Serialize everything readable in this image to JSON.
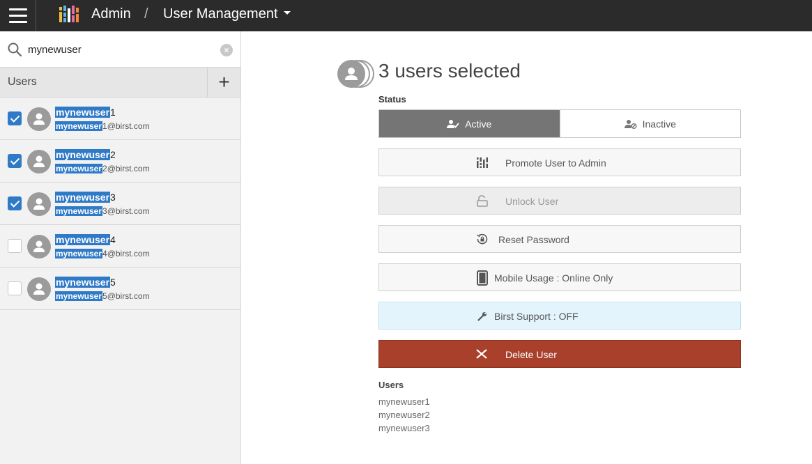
{
  "header": {
    "app": "Admin",
    "separator": "/",
    "section": "User Management"
  },
  "search": {
    "value": "mynewuser",
    "placeholder": ""
  },
  "users_panel": {
    "title": "Users",
    "add_label": "+"
  },
  "users": [
    {
      "match": "mynewuser",
      "suffix": "1",
      "email_suffix": "1@birst.com",
      "checked": true
    },
    {
      "match": "mynewuser",
      "suffix": "2",
      "email_suffix": "2@birst.com",
      "checked": true
    },
    {
      "match": "mynewuser",
      "suffix": "3",
      "email_suffix": "3@birst.com",
      "checked": true
    },
    {
      "match": "mynewuser",
      "suffix": "4",
      "email_suffix": "4@birst.com",
      "checked": false
    },
    {
      "match": "mynewuser",
      "suffix": "5",
      "email_suffix": "5@birst.com",
      "checked": false
    }
  ],
  "detail": {
    "headline": "3 users selected",
    "status_label": "Status",
    "status_active": "Active",
    "status_inactive": "Inactive",
    "promote": "Promote User to Admin",
    "unlock": "Unlock User",
    "reset": "Reset Password",
    "mobile": "Mobile Usage : Online Only",
    "support": "Birst Support : OFF",
    "delete": "Delete User",
    "users_label": "Users",
    "selected_users": [
      "mynewuser1",
      "mynewuser2",
      "mynewuser3"
    ]
  },
  "colors": {
    "topbar": "#2b2b2b",
    "highlight": "#2f7ac7",
    "active_segment": "#757575",
    "support_bg": "#e3f4fd",
    "delete_bg": "#a8402b"
  }
}
